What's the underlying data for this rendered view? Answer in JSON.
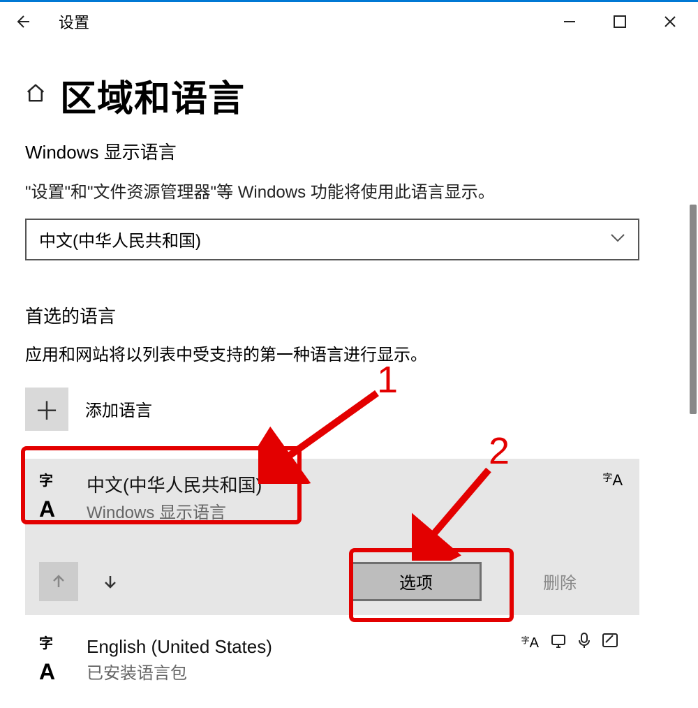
{
  "window": {
    "title": "设置"
  },
  "header": {
    "page_title": "区域和语言"
  },
  "display_language": {
    "heading": "Windows 显示语言",
    "description": "\"设置\"和\"文件资源管理器\"等 Windows 功能将使用此语言显示。",
    "selected": "中文(中华人民共和国)"
  },
  "preferred_languages": {
    "heading": "首选的语言",
    "description": "应用和网站将以列表中受支持的第一种语言进行显示。",
    "add_label": "添加语言",
    "items": [
      {
        "name": "中文(中华人民共和国)",
        "subtitle": "Windows 显示语言",
        "options_label": "选项",
        "delete_label": "删除"
      },
      {
        "name": "English (United States)",
        "subtitle": "已安装语言包"
      }
    ]
  },
  "annotations": {
    "label1": "1",
    "label2": "2"
  }
}
